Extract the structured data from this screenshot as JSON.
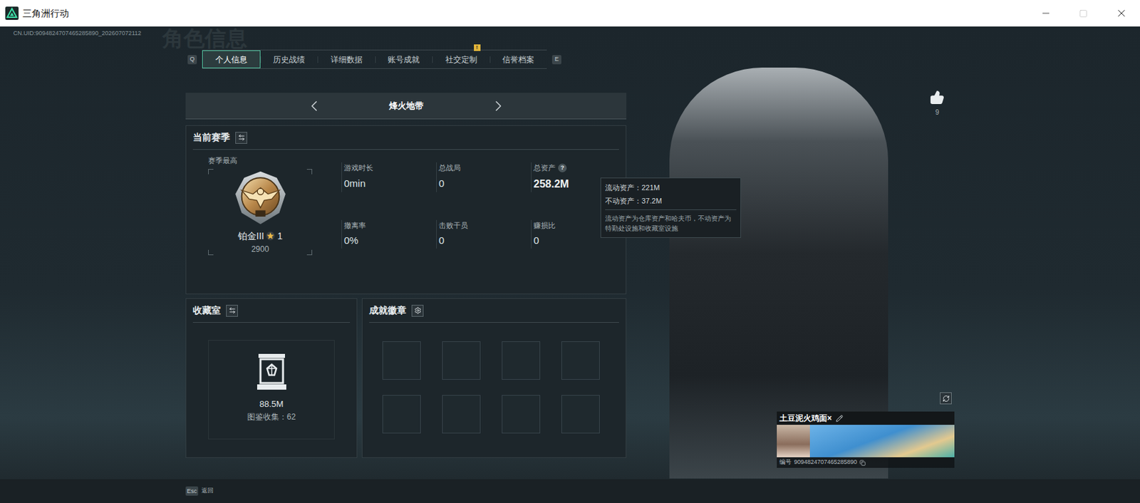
{
  "window": {
    "title": "三角洲行动"
  },
  "uid": "CN.UID:9094824707465285890_202607072112",
  "background_title": "角色信息",
  "tabs": {
    "prev_key": "Q",
    "next_key": "E",
    "items": [
      {
        "label": "个人信息",
        "selected": true
      },
      {
        "label": "历史战绩",
        "selected": false
      },
      {
        "label": "详细数据",
        "selected": false
      },
      {
        "label": "账号成就",
        "selected": false
      },
      {
        "label": "社交定制",
        "selected": false,
        "badge": "!"
      },
      {
        "label": "信誉档案",
        "selected": false
      }
    ]
  },
  "mode": {
    "label": "烽火地带"
  },
  "season": {
    "title": "当前赛季",
    "best_label": "赛季最高",
    "rank": "铂金III",
    "star_count": "1",
    "score": "2900",
    "stats": [
      {
        "label": "游戏时长",
        "value": "0min"
      },
      {
        "label": "总战局",
        "value": "0"
      },
      {
        "label": "总资产",
        "value": "258.2M",
        "help_icon": "?"
      },
      {
        "label": "撤离率",
        "value": "0%"
      },
      {
        "label": "击败干员",
        "value": "0"
      },
      {
        "label": "赚损比",
        "value": "0"
      }
    ]
  },
  "tooltip": {
    "lines": [
      "流动资产：221M",
      "不动资产：37.2M"
    ],
    "note": "流动资产为仓库资产和哈夫币，不动资产为特勤处设施和收藏室设施"
  },
  "collection": {
    "title": "收藏室",
    "value": "88.5M",
    "caption": "图鉴收集：62"
  },
  "achievements": {
    "title": "成就徽章",
    "slots": [
      {
        "filled": false
      },
      {
        "filled": false
      },
      {
        "filled": false
      },
      {
        "filled": false
      },
      {
        "filled": false
      },
      {
        "filled": false
      },
      {
        "filled": false
      },
      {
        "filled": false
      }
    ]
  },
  "likes": {
    "count": "9"
  },
  "profile_card": {
    "name": "土豆泥火鸡面×",
    "id_label": "编号",
    "id": "9094824707465285890"
  },
  "footer": {
    "key": "Esc",
    "label": "返回"
  }
}
